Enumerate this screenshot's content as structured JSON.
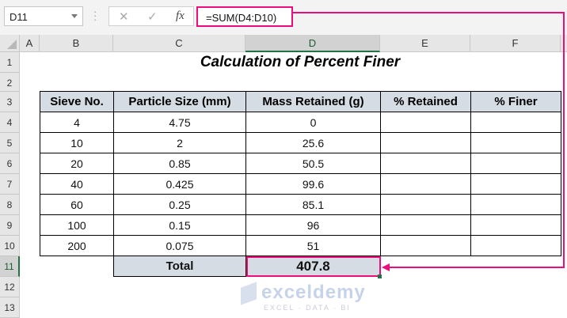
{
  "formula_bar": {
    "name_box": "D11",
    "cancel_icon": "✕",
    "enter_icon": "✓",
    "fx_label": "fx",
    "formula": "=SUM(D4:D10)"
  },
  "columns": [
    "A",
    "B",
    "C",
    "D",
    "E",
    "F"
  ],
  "rows": [
    "1",
    "2",
    "3",
    "4",
    "5",
    "6",
    "7",
    "8",
    "9",
    "10",
    "11",
    "12",
    "13"
  ],
  "title": "Calculation of Percent Finer",
  "table": {
    "headers": [
      "Sieve No.",
      "Particle Size (mm)",
      "Mass Retained (g)",
      "% Retained",
      "% Finer"
    ],
    "rows": [
      [
        "4",
        "4.75",
        "0",
        "",
        ""
      ],
      [
        "10",
        "2",
        "25.6",
        "",
        ""
      ],
      [
        "20",
        "0.85",
        "50.5",
        "",
        ""
      ],
      [
        "40",
        "0.425",
        "99.6",
        "",
        ""
      ],
      [
        "60",
        "0.25",
        "85.1",
        "",
        ""
      ],
      [
        "100",
        "0.15",
        "96",
        "",
        ""
      ],
      [
        "200",
        "0.075",
        "51",
        "",
        ""
      ]
    ],
    "total_label": "Total",
    "total_value": "407.8"
  },
  "watermark": {
    "name": "exceldemy",
    "tagline": "EXCEL · DATA · BI"
  },
  "accent": "#ec0c7c"
}
